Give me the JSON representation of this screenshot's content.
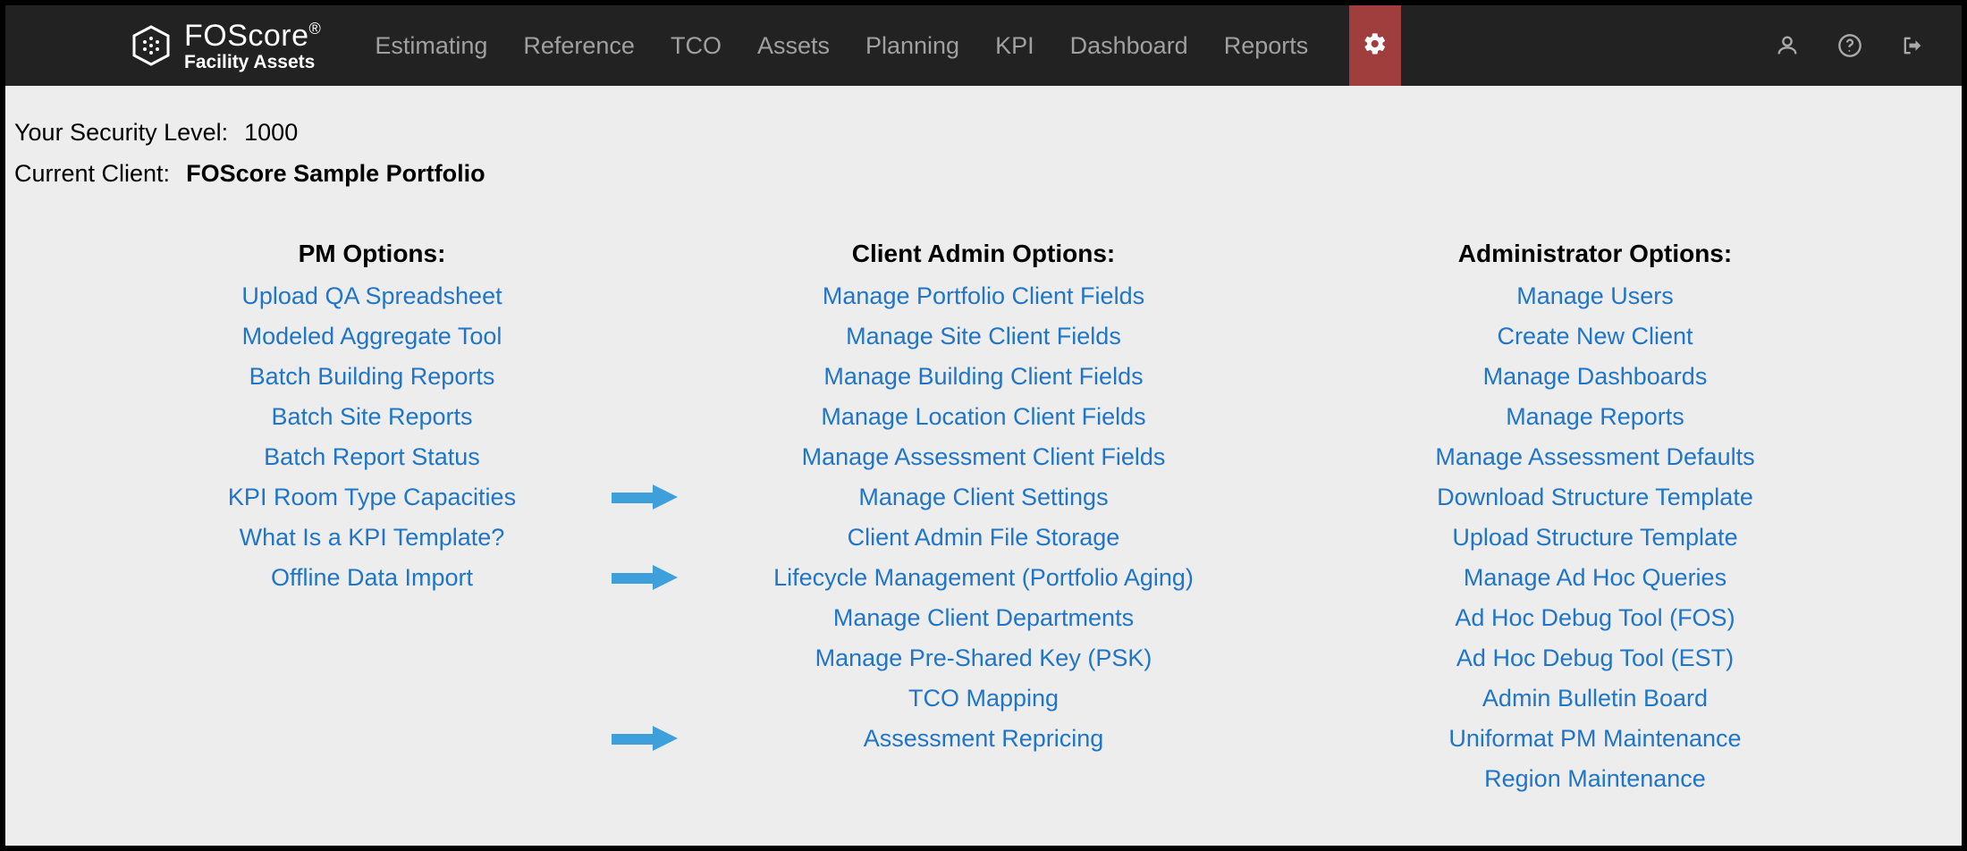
{
  "brand": {
    "name": "FOScore",
    "reg": "®",
    "tagline": "Facility Assets"
  },
  "nav": {
    "items": [
      "Estimating",
      "Reference",
      "TCO",
      "Assets",
      "Planning",
      "KPI",
      "Dashboard",
      "Reports"
    ]
  },
  "meta": {
    "security_label": "Your Security Level:",
    "security_value": "1000",
    "client_label": "Current Client:",
    "client_value": "FOScore Sample Portfolio"
  },
  "columns": {
    "pm": {
      "heading": "PM Options:",
      "links": [
        "Upload QA Spreadsheet",
        "Modeled Aggregate Tool",
        "Batch Building Reports",
        "Batch Site Reports",
        "Batch Report Status",
        "KPI Room Type Capacities",
        "What Is a KPI Template?",
        "Offline Data Import"
      ]
    },
    "clientadmin": {
      "heading": "Client Admin Options:",
      "links": [
        "Manage Portfolio Client Fields",
        "Manage Site Client Fields",
        "Manage Building Client Fields",
        "Manage Location Client Fields",
        "Manage Assessment Client Fields",
        "Manage Client Settings",
        "Client Admin File Storage",
        "Lifecycle Management (Portfolio Aging)",
        "Manage Client Departments",
        "Manage Pre-Shared Key (PSK)",
        "TCO Mapping",
        "Assessment Repricing"
      ],
      "arrows_at": [
        5,
        7,
        11
      ]
    },
    "admin": {
      "heading": "Administrator Options:",
      "links": [
        "Manage Users",
        "Create New Client",
        "Manage Dashboards",
        "Manage Reports",
        "Manage Assessment Defaults",
        "Download Structure Template",
        "Upload Structure Template",
        "Manage Ad Hoc Queries",
        "Ad Hoc Debug Tool (FOS)",
        "Ad Hoc Debug Tool (EST)",
        "Admin Bulletin Board",
        "Uniformat PM Maintenance",
        "Region Maintenance"
      ]
    }
  }
}
